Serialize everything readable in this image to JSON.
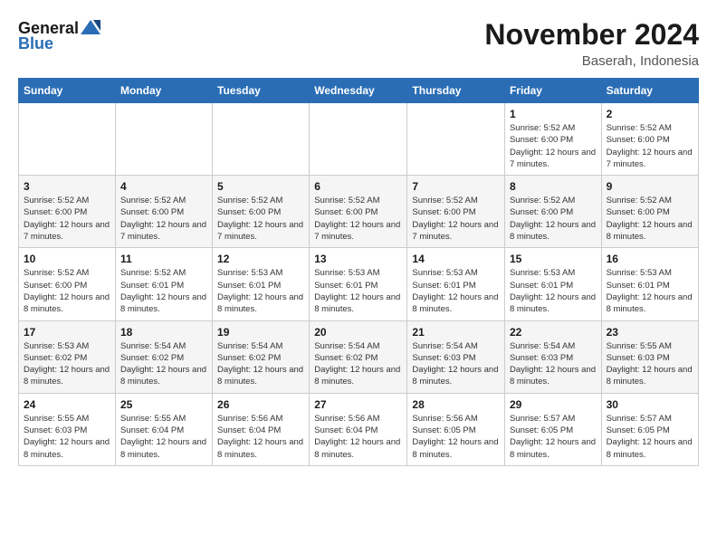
{
  "header": {
    "logo_general": "General",
    "logo_blue": "Blue",
    "month_title": "November 2024",
    "location": "Baserah, Indonesia"
  },
  "days_of_week": [
    "Sunday",
    "Monday",
    "Tuesday",
    "Wednesday",
    "Thursday",
    "Friday",
    "Saturday"
  ],
  "weeks": [
    [
      {
        "day": "",
        "info": ""
      },
      {
        "day": "",
        "info": ""
      },
      {
        "day": "",
        "info": ""
      },
      {
        "day": "",
        "info": ""
      },
      {
        "day": "",
        "info": ""
      },
      {
        "day": "1",
        "info": "Sunrise: 5:52 AM\nSunset: 6:00 PM\nDaylight: 12 hours and 7 minutes."
      },
      {
        "day": "2",
        "info": "Sunrise: 5:52 AM\nSunset: 6:00 PM\nDaylight: 12 hours and 7 minutes."
      }
    ],
    [
      {
        "day": "3",
        "info": "Sunrise: 5:52 AM\nSunset: 6:00 PM\nDaylight: 12 hours and 7 minutes."
      },
      {
        "day": "4",
        "info": "Sunrise: 5:52 AM\nSunset: 6:00 PM\nDaylight: 12 hours and 7 minutes."
      },
      {
        "day": "5",
        "info": "Sunrise: 5:52 AM\nSunset: 6:00 PM\nDaylight: 12 hours and 7 minutes."
      },
      {
        "day": "6",
        "info": "Sunrise: 5:52 AM\nSunset: 6:00 PM\nDaylight: 12 hours and 7 minutes."
      },
      {
        "day": "7",
        "info": "Sunrise: 5:52 AM\nSunset: 6:00 PM\nDaylight: 12 hours and 7 minutes."
      },
      {
        "day": "8",
        "info": "Sunrise: 5:52 AM\nSunset: 6:00 PM\nDaylight: 12 hours and 8 minutes."
      },
      {
        "day": "9",
        "info": "Sunrise: 5:52 AM\nSunset: 6:00 PM\nDaylight: 12 hours and 8 minutes."
      }
    ],
    [
      {
        "day": "10",
        "info": "Sunrise: 5:52 AM\nSunset: 6:00 PM\nDaylight: 12 hours and 8 minutes."
      },
      {
        "day": "11",
        "info": "Sunrise: 5:52 AM\nSunset: 6:01 PM\nDaylight: 12 hours and 8 minutes."
      },
      {
        "day": "12",
        "info": "Sunrise: 5:53 AM\nSunset: 6:01 PM\nDaylight: 12 hours and 8 minutes."
      },
      {
        "day": "13",
        "info": "Sunrise: 5:53 AM\nSunset: 6:01 PM\nDaylight: 12 hours and 8 minutes."
      },
      {
        "day": "14",
        "info": "Sunrise: 5:53 AM\nSunset: 6:01 PM\nDaylight: 12 hours and 8 minutes."
      },
      {
        "day": "15",
        "info": "Sunrise: 5:53 AM\nSunset: 6:01 PM\nDaylight: 12 hours and 8 minutes."
      },
      {
        "day": "16",
        "info": "Sunrise: 5:53 AM\nSunset: 6:01 PM\nDaylight: 12 hours and 8 minutes."
      }
    ],
    [
      {
        "day": "17",
        "info": "Sunrise: 5:53 AM\nSunset: 6:02 PM\nDaylight: 12 hours and 8 minutes."
      },
      {
        "day": "18",
        "info": "Sunrise: 5:54 AM\nSunset: 6:02 PM\nDaylight: 12 hours and 8 minutes."
      },
      {
        "day": "19",
        "info": "Sunrise: 5:54 AM\nSunset: 6:02 PM\nDaylight: 12 hours and 8 minutes."
      },
      {
        "day": "20",
        "info": "Sunrise: 5:54 AM\nSunset: 6:02 PM\nDaylight: 12 hours and 8 minutes."
      },
      {
        "day": "21",
        "info": "Sunrise: 5:54 AM\nSunset: 6:03 PM\nDaylight: 12 hours and 8 minutes."
      },
      {
        "day": "22",
        "info": "Sunrise: 5:54 AM\nSunset: 6:03 PM\nDaylight: 12 hours and 8 minutes."
      },
      {
        "day": "23",
        "info": "Sunrise: 5:55 AM\nSunset: 6:03 PM\nDaylight: 12 hours and 8 minutes."
      }
    ],
    [
      {
        "day": "24",
        "info": "Sunrise: 5:55 AM\nSunset: 6:03 PM\nDaylight: 12 hours and 8 minutes."
      },
      {
        "day": "25",
        "info": "Sunrise: 5:55 AM\nSunset: 6:04 PM\nDaylight: 12 hours and 8 minutes."
      },
      {
        "day": "26",
        "info": "Sunrise: 5:56 AM\nSunset: 6:04 PM\nDaylight: 12 hours and 8 minutes."
      },
      {
        "day": "27",
        "info": "Sunrise: 5:56 AM\nSunset: 6:04 PM\nDaylight: 12 hours and 8 minutes."
      },
      {
        "day": "28",
        "info": "Sunrise: 5:56 AM\nSunset: 6:05 PM\nDaylight: 12 hours and 8 minutes."
      },
      {
        "day": "29",
        "info": "Sunrise: 5:57 AM\nSunset: 6:05 PM\nDaylight: 12 hours and 8 minutes."
      },
      {
        "day": "30",
        "info": "Sunrise: 5:57 AM\nSunset: 6:05 PM\nDaylight: 12 hours and 8 minutes."
      }
    ]
  ]
}
